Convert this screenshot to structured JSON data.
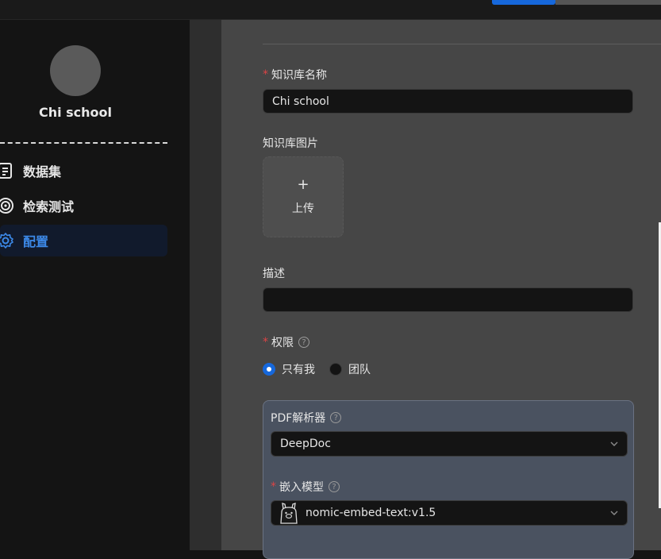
{
  "sidebar": {
    "kb_name": "Chi school",
    "items": [
      {
        "label": "数据集",
        "icon": "dataset-icon"
      },
      {
        "label": "检索测试",
        "icon": "target-icon"
      },
      {
        "label": "配置",
        "icon": "gear-icon"
      }
    ],
    "active_index": 2
  },
  "form": {
    "name_label": "知识库名称",
    "name_value": "Chi school",
    "image_label": "知识库图片",
    "upload_label": "上传",
    "upload_plus": "+",
    "description_label": "描述",
    "description_value": "",
    "permission_label": "权限",
    "permission_options": [
      "只有我",
      "团队"
    ],
    "permission_selected": 0,
    "parser_label": "PDF解析器",
    "parser_value": "DeepDoc",
    "embed_label": "嵌入模型",
    "embed_value": "nomic-embed-text:v1.5",
    "help_glyph": "?"
  },
  "colors": {
    "accent": "#1668dc",
    "required": "#dc4446",
    "active_nav_bg": "#111a2c",
    "active_nav_text": "#3c89e8"
  }
}
